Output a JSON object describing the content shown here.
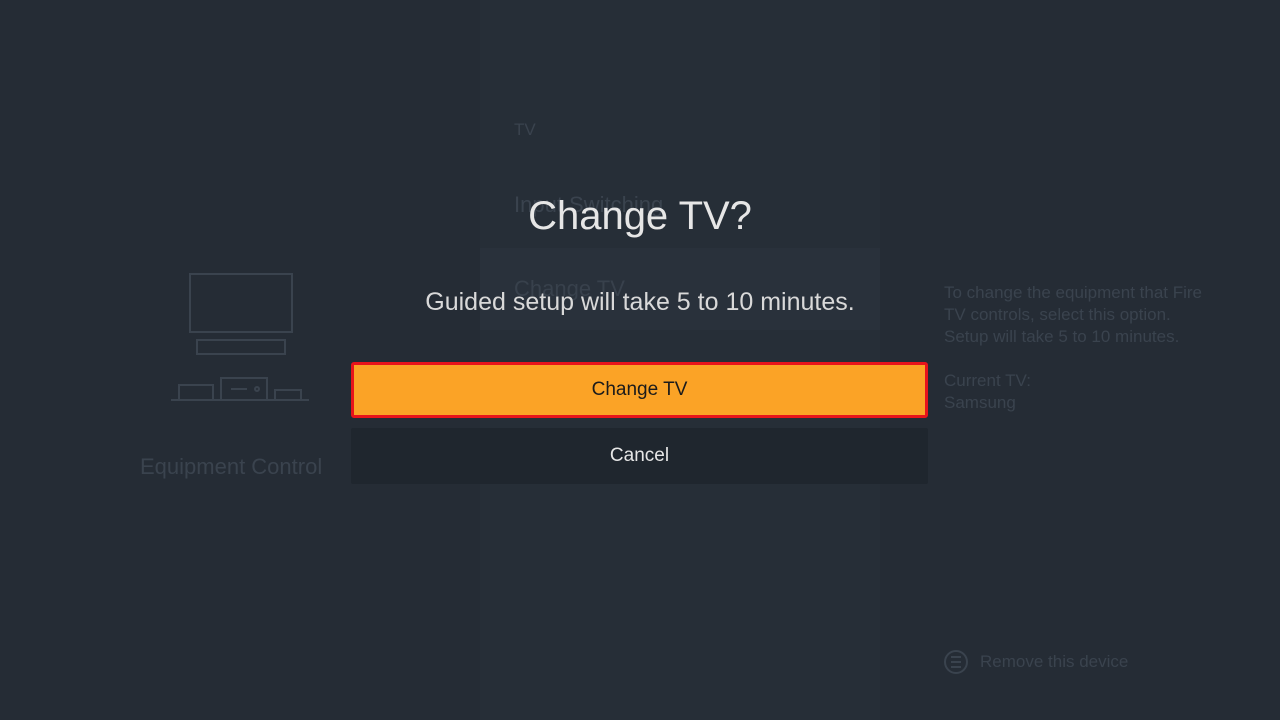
{
  "background": {
    "left_panel": {
      "icon": "equipment-tv-icon",
      "label": "Equipment Control"
    },
    "menu": {
      "heading": "TV",
      "items": [
        {
          "label": "Input Switching"
        },
        {
          "label": "Change TV"
        }
      ]
    },
    "details": {
      "description": "To change the equipment that Fire TV controls, select this option. Setup will take 5 to 10 minutes.",
      "current_label": "Current TV:",
      "current_value": "Samsung"
    },
    "footer": {
      "icon": "menu-icon",
      "label": "Remove this device"
    }
  },
  "dialog": {
    "title": "Change TV?",
    "message": "Guided setup will take 5 to 10 minutes.",
    "buttons": {
      "primary": "Change TV",
      "secondary": "Cancel"
    }
  },
  "colors": {
    "accent": "#fba326",
    "focus_border": "#e8141b",
    "background": "#252c35"
  }
}
